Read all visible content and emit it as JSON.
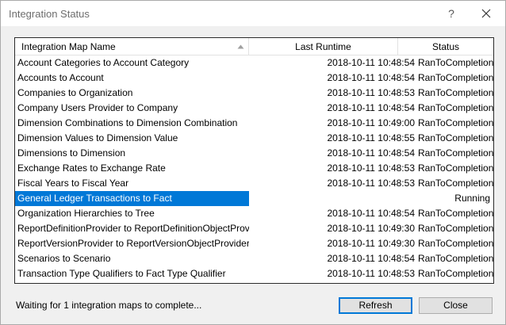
{
  "window": {
    "title": "Integration Status",
    "help_label": "?"
  },
  "grid": {
    "columns": [
      "Integration Map Name",
      "Last Runtime",
      "Status"
    ],
    "sort": "ascending",
    "rows": [
      {
        "name": "Account Categories to Account Category",
        "runtime": "2018-10-11 10:48:54",
        "status": "RanToCompletion"
      },
      {
        "name": "Accounts to Account",
        "runtime": "2018-10-11 10:48:54",
        "status": "RanToCompletion"
      },
      {
        "name": "Companies to Organization",
        "runtime": "2018-10-11 10:48:53",
        "status": "RanToCompletion"
      },
      {
        "name": "Company Users Provider to Company",
        "runtime": "2018-10-11 10:48:54",
        "status": "RanToCompletion"
      },
      {
        "name": "Dimension Combinations to Dimension Combination",
        "runtime": "2018-10-11 10:49:00",
        "status": "RanToCompletion"
      },
      {
        "name": "Dimension Values to Dimension Value",
        "runtime": "2018-10-11 10:48:55",
        "status": "RanToCompletion"
      },
      {
        "name": "Dimensions to Dimension",
        "runtime": "2018-10-11 10:48:54",
        "status": "RanToCompletion"
      },
      {
        "name": "Exchange Rates to Exchange Rate",
        "runtime": "2018-10-11 10:48:53",
        "status": "RanToCompletion"
      },
      {
        "name": "Fiscal Years to Fiscal Year",
        "runtime": "2018-10-11 10:48:53",
        "status": "RanToCompletion"
      },
      {
        "name": "General Ledger Transactions to Fact",
        "runtime": "",
        "status": "Running",
        "selected": true
      },
      {
        "name": "Organization Hierarchies to Tree",
        "runtime": "2018-10-11 10:48:54",
        "status": "RanToCompletion"
      },
      {
        "name": "ReportDefinitionProvider to ReportDefinitionObjectProvider",
        "runtime": "2018-10-11 10:49:30",
        "status": "RanToCompletion"
      },
      {
        "name": "ReportVersionProvider to ReportVersionObjectProvider",
        "runtime": "2018-10-11 10:49:30",
        "status": "RanToCompletion"
      },
      {
        "name": "Scenarios to Scenario",
        "runtime": "2018-10-11 10:48:54",
        "status": "RanToCompletion"
      },
      {
        "name": "Transaction Type Qualifiers to Fact Type Qualifier",
        "runtime": "2018-10-11 10:48:53",
        "status": "RanToCompletion"
      }
    ]
  },
  "footer": {
    "status_text": "Waiting for 1 integration maps to complete...",
    "refresh_label": "Refresh",
    "close_label": "Close"
  },
  "colors": {
    "selection": "#0078d7",
    "default_button_border": "#0078d7"
  },
  "icons": {
    "close": "close-icon",
    "sort": "sort-ascending-icon"
  }
}
